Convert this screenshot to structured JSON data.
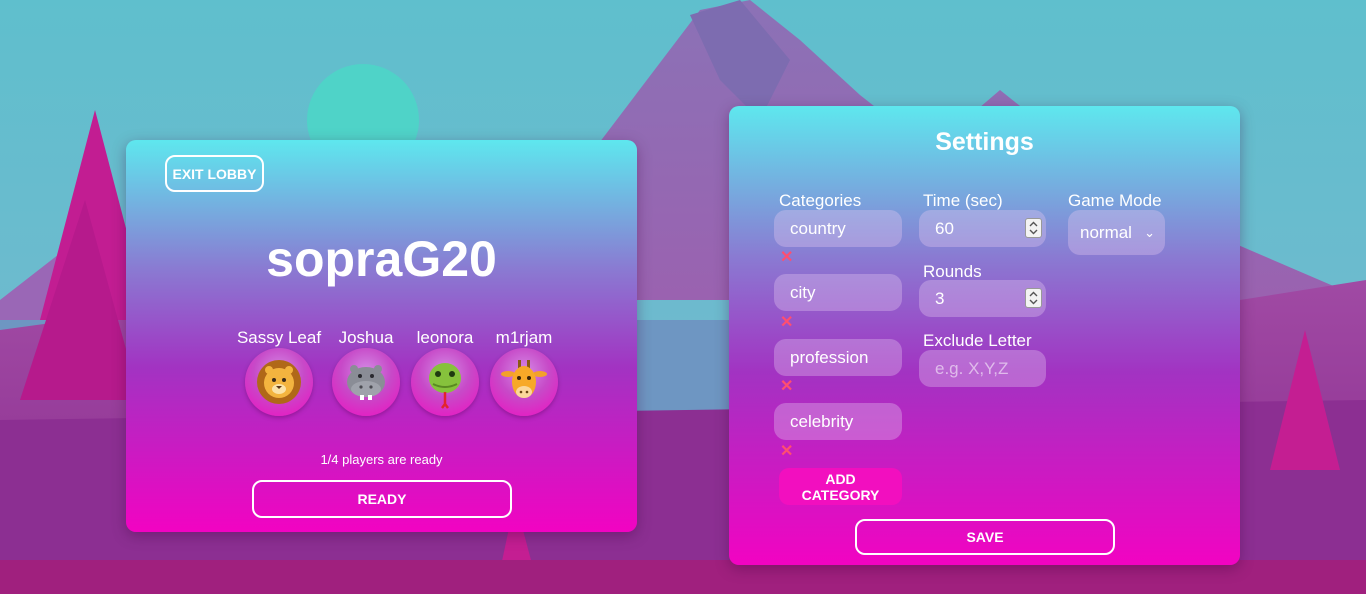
{
  "lobby": {
    "exit_label": "EXIT LOBBY",
    "title": "sopraG20",
    "players": [
      {
        "name": "Sassy Leaf",
        "avatar": "lion-icon"
      },
      {
        "name": "Joshua",
        "avatar": "hippo-icon"
      },
      {
        "name": "leonora",
        "avatar": "snake-icon"
      },
      {
        "name": "m1rjam",
        "avatar": "giraffe-icon"
      }
    ],
    "ready_status": "1/4 players are ready",
    "ready_label": "READY"
  },
  "settings": {
    "title": "Settings",
    "categories_label": "Categories",
    "categories": [
      "country",
      "city",
      "profession",
      "celebrity"
    ],
    "remove_symbol": "✕",
    "add_category_label_line1": "ADD",
    "add_category_label_line2": "CATEGORY",
    "time_label": "Time (sec)",
    "time_value": "60",
    "rounds_label": "Rounds",
    "rounds_value": "3",
    "exclude_label": "Exclude Letter",
    "exclude_placeholder": "e.g. X,Y,Z",
    "mode_label": "Game Mode",
    "mode_value": "normal",
    "save_label": "SAVE"
  },
  "colors": {
    "accent_pink": "#f20fbf",
    "remove_red": "#ff4e70",
    "card_top": "#5ee7ee",
    "card_bottom": "#f203c2"
  }
}
